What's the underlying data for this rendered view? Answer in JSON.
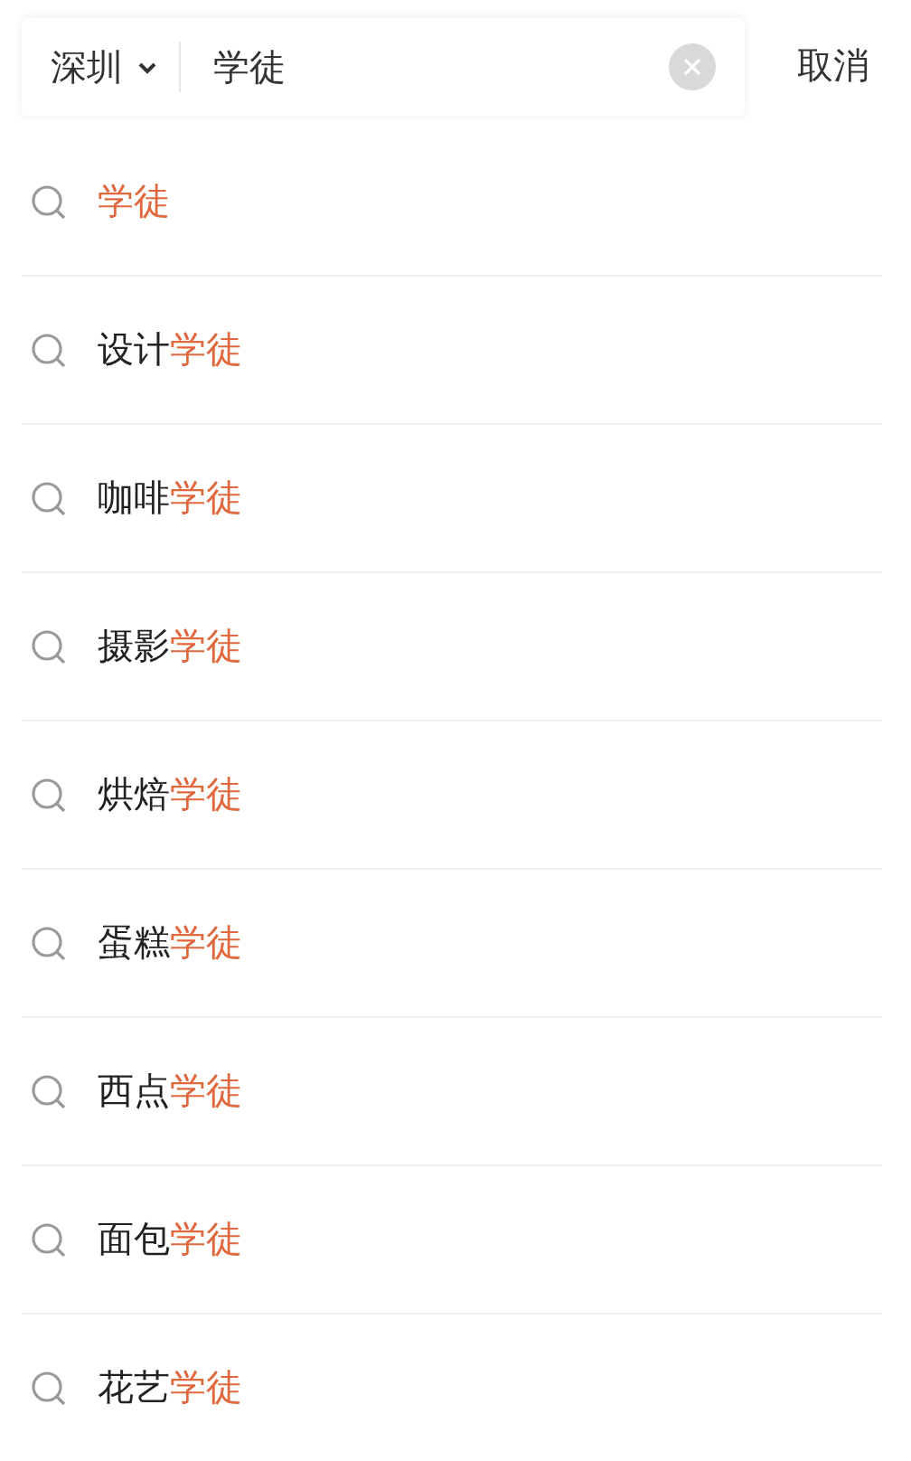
{
  "search_bar": {
    "city": "深圳",
    "query": "学徒",
    "cancel": "取消"
  },
  "suggestions": [
    {
      "match": "学徒"
    },
    {
      "prefix": "设计",
      "match": "学徒"
    },
    {
      "prefix": "咖啡",
      "match": "学徒"
    },
    {
      "prefix": "摄影",
      "match": "学徒"
    },
    {
      "prefix": "烘焙",
      "match": "学徒"
    },
    {
      "prefix": "蛋糕",
      "match": "学徒"
    },
    {
      "prefix": "西点",
      "match": "学徒"
    },
    {
      "prefix": "面包",
      "match": "学徒"
    },
    {
      "prefix": "花艺",
      "match": "学徒"
    }
  ]
}
